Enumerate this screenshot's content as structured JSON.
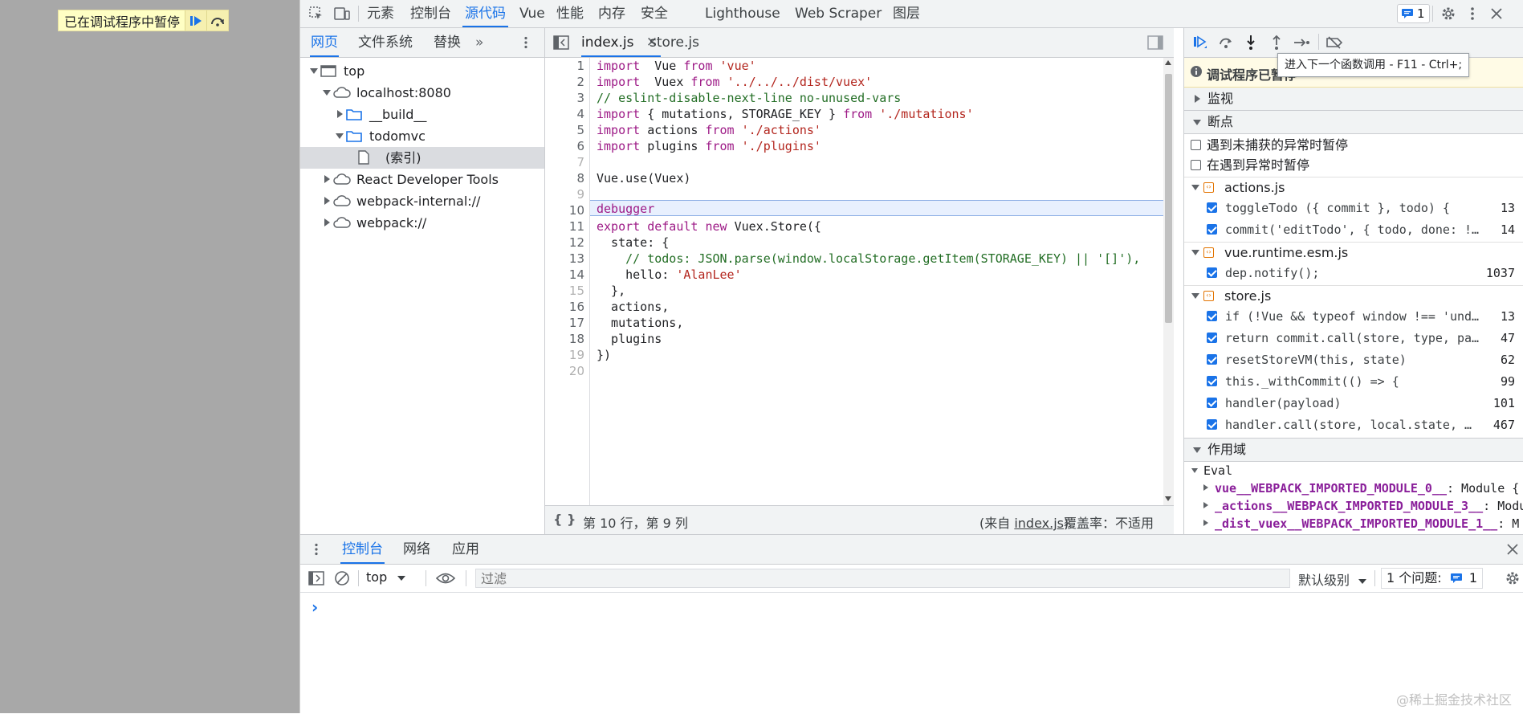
{
  "paused_banner": {
    "text": "已在调试程序中暂停"
  },
  "toolbar": {
    "tabs": [
      "元素",
      "控制台",
      "源代码",
      "Vue",
      "性能",
      "内存",
      "安全",
      "Lighthouse",
      "Web Scraper",
      "图层"
    ],
    "active_tab": "源代码",
    "issues_count": "1"
  },
  "navigator": {
    "tabs": [
      "网页",
      "文件系统",
      "替换"
    ],
    "tree": [
      {
        "label": "top"
      },
      {
        "label": "localhost:8080"
      },
      {
        "label": "__build__"
      },
      {
        "label": "todomvc"
      },
      {
        "label": "(索引)"
      },
      {
        "label": "React Developer Tools"
      },
      {
        "label": "webpack-internal://"
      },
      {
        "label": "webpack://"
      }
    ]
  },
  "editor": {
    "tabs": [
      {
        "label": "index.js"
      },
      {
        "label": "store.js"
      }
    ],
    "line_numbers": [
      "1",
      "2",
      "3",
      "4",
      "5",
      "6",
      "7",
      "8",
      "9",
      "10",
      "11",
      "12",
      "13",
      "14",
      "15",
      "16",
      "17",
      "18",
      "19",
      "20"
    ],
    "status": {
      "position": "第 10 行，第 9 列",
      "from_prefix": "(来自 ",
      "from_file": "index.js",
      "from_suffix": ")",
      "coverage": "覆盖率：不适用"
    }
  },
  "debugger": {
    "paused_message": "调试程序已暂停",
    "tooltip": "进入下一个函数调用 - F11 - Ctrl+;",
    "sections": {
      "watch": "监视",
      "breakpoints": "断点",
      "scope": "作用域"
    },
    "pause_options": [
      {
        "label": "遇到未捕获的异常时暂停",
        "checked": false
      },
      {
        "label": "在遇到异常时暂停",
        "checked": false
      }
    ],
    "breakpoint_files": [
      {
        "file": "actions.js",
        "items": [
          {
            "code": "toggleTodo ({ commit }, todo) {",
            "line": "13"
          },
          {
            "code": "commit('editTodo', { todo, done: !…",
            "line": "14"
          }
        ]
      },
      {
        "file": "vue.runtime.esm.js",
        "items": [
          {
            "code": "dep.notify();",
            "line": "1037"
          }
        ]
      },
      {
        "file": "store.js",
        "items": [
          {
            "code": "if (!Vue && typeof window !== 'und…",
            "line": "13"
          },
          {
            "code": "return commit.call(store, type, pa…",
            "line": "47"
          },
          {
            "code": "resetStoreVM(this, state)",
            "line": "62"
          },
          {
            "code": "this._withCommit(() => {",
            "line": "99"
          },
          {
            "code": "handler(payload)",
            "line": "101"
          },
          {
            "code": "handler.call(store, local.state, …",
            "line": "467"
          }
        ]
      }
    ],
    "scope": {
      "group": "Eval",
      "items": [
        {
          "key": "vue__WEBPACK_IMPORTED_MODULE_0__",
          "value": ": Module {"
        },
        {
          "key": "_actions__WEBPACK_IMPORTED_MODULE_3__",
          "value": ": Modu"
        },
        {
          "key": "_dist_vuex__WEBPACK_IMPORTED_MODULE_1__",
          "value": ": M"
        }
      ]
    }
  },
  "drawer": {
    "tabs": [
      "控制台",
      "网络",
      "应用"
    ],
    "context": "top",
    "filter_placeholder": "过滤",
    "level": "默认级别",
    "issues_label": "1 个问题:",
    "issues_count": "1",
    "prompt": "›"
  },
  "watermark": "@稀土掘金技术社区",
  "colors": {
    "accent": "#1a73e8",
    "paused_banner": "#ffffc4",
    "exec_line": "#e8f0fe"
  }
}
